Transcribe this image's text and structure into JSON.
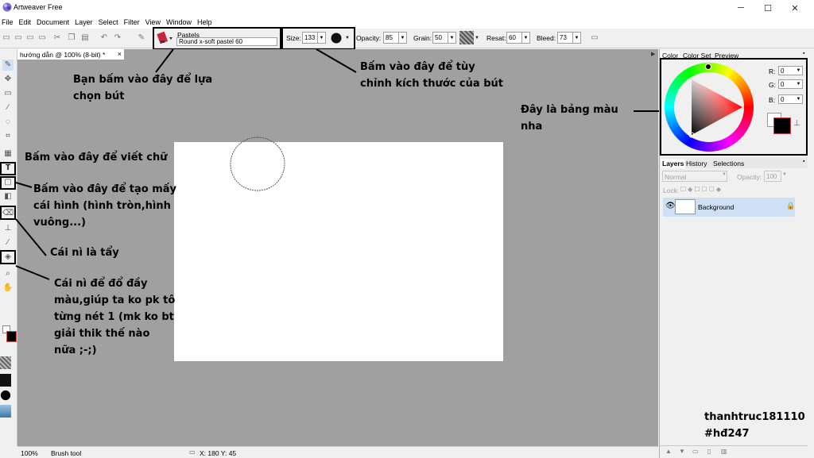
{
  "window": {
    "title": "Artweaver Free",
    "minimize_symbol": "─",
    "maximize_symbol": "☐",
    "close_symbol": "✕"
  },
  "menu": [
    "File",
    "Edit",
    "Document",
    "Layer",
    "Select",
    "Filter",
    "View",
    "Window",
    "Help"
  ],
  "toolbar": {
    "brush_category": "Pastels",
    "brush_variant": "Round x-soft pastel 60",
    "size_label": "Size:",
    "size_value": "133",
    "opacity_label": "Opacity:",
    "opacity_value": "85",
    "grain_label": "Grain:",
    "grain_value": "50",
    "resat_label": "Resat:",
    "resat_value": "60",
    "bleed_label": "Bleed:",
    "bleed_value": "73"
  },
  "document_tab": {
    "label": "hướng dẫn @ 100% (8-bit) *",
    "close": "×"
  },
  "annotations": {
    "brush_pick": [
      "Bạn bấm vào đây để lựa",
      "chọn bút"
    ],
    "brush_size": [
      "Bấm vào đây để tùy",
      "chỉnh kích thước của bút"
    ],
    "color_panel": [
      "Đây là bảng màu",
      "nha"
    ],
    "text_tool": [
      "Bấm vào đây để viết chữ"
    ],
    "shape_tool": [
      "Bấm vào đây để tạo mấy",
      "cái hình (hình tròn,hình",
      "vuông...)"
    ],
    "eraser_tool": [
      "Cái nì là tẩy"
    ],
    "fill_tool": [
      "Cái nì để đổ đầy",
      "màu,giúp ta ko pk tô",
      "từng nét 1 (mk ko bt",
      "giải thik thế nào",
      "nữa ;-;)"
    ],
    "credit": [
      "thanhtruc181110",
      "#hđ247"
    ]
  },
  "color_panel": {
    "tabs": [
      "Color",
      "Color Set",
      "Preview"
    ],
    "r_label": "R:",
    "g_label": "G:",
    "b_label": "B:",
    "r_value": "0",
    "g_value": "0",
    "b_value": "0",
    "foreground": "#000000",
    "background": "#ffffff"
  },
  "layers_panel": {
    "tabs": [
      "Layers",
      "History",
      "Selections"
    ],
    "blend_mode": "Normal",
    "opacity_label": "Opacity:",
    "opacity_value": "100",
    "lock_label": "Lock:",
    "layer_name": "Background"
  },
  "statusbar": {
    "zoom": "100%",
    "tool": "Brush tool",
    "coords": "X: 180  Y: 45"
  },
  "colors": {
    "accent_selection": "#cfe0f4",
    "workspace": "#a0a0a0"
  }
}
